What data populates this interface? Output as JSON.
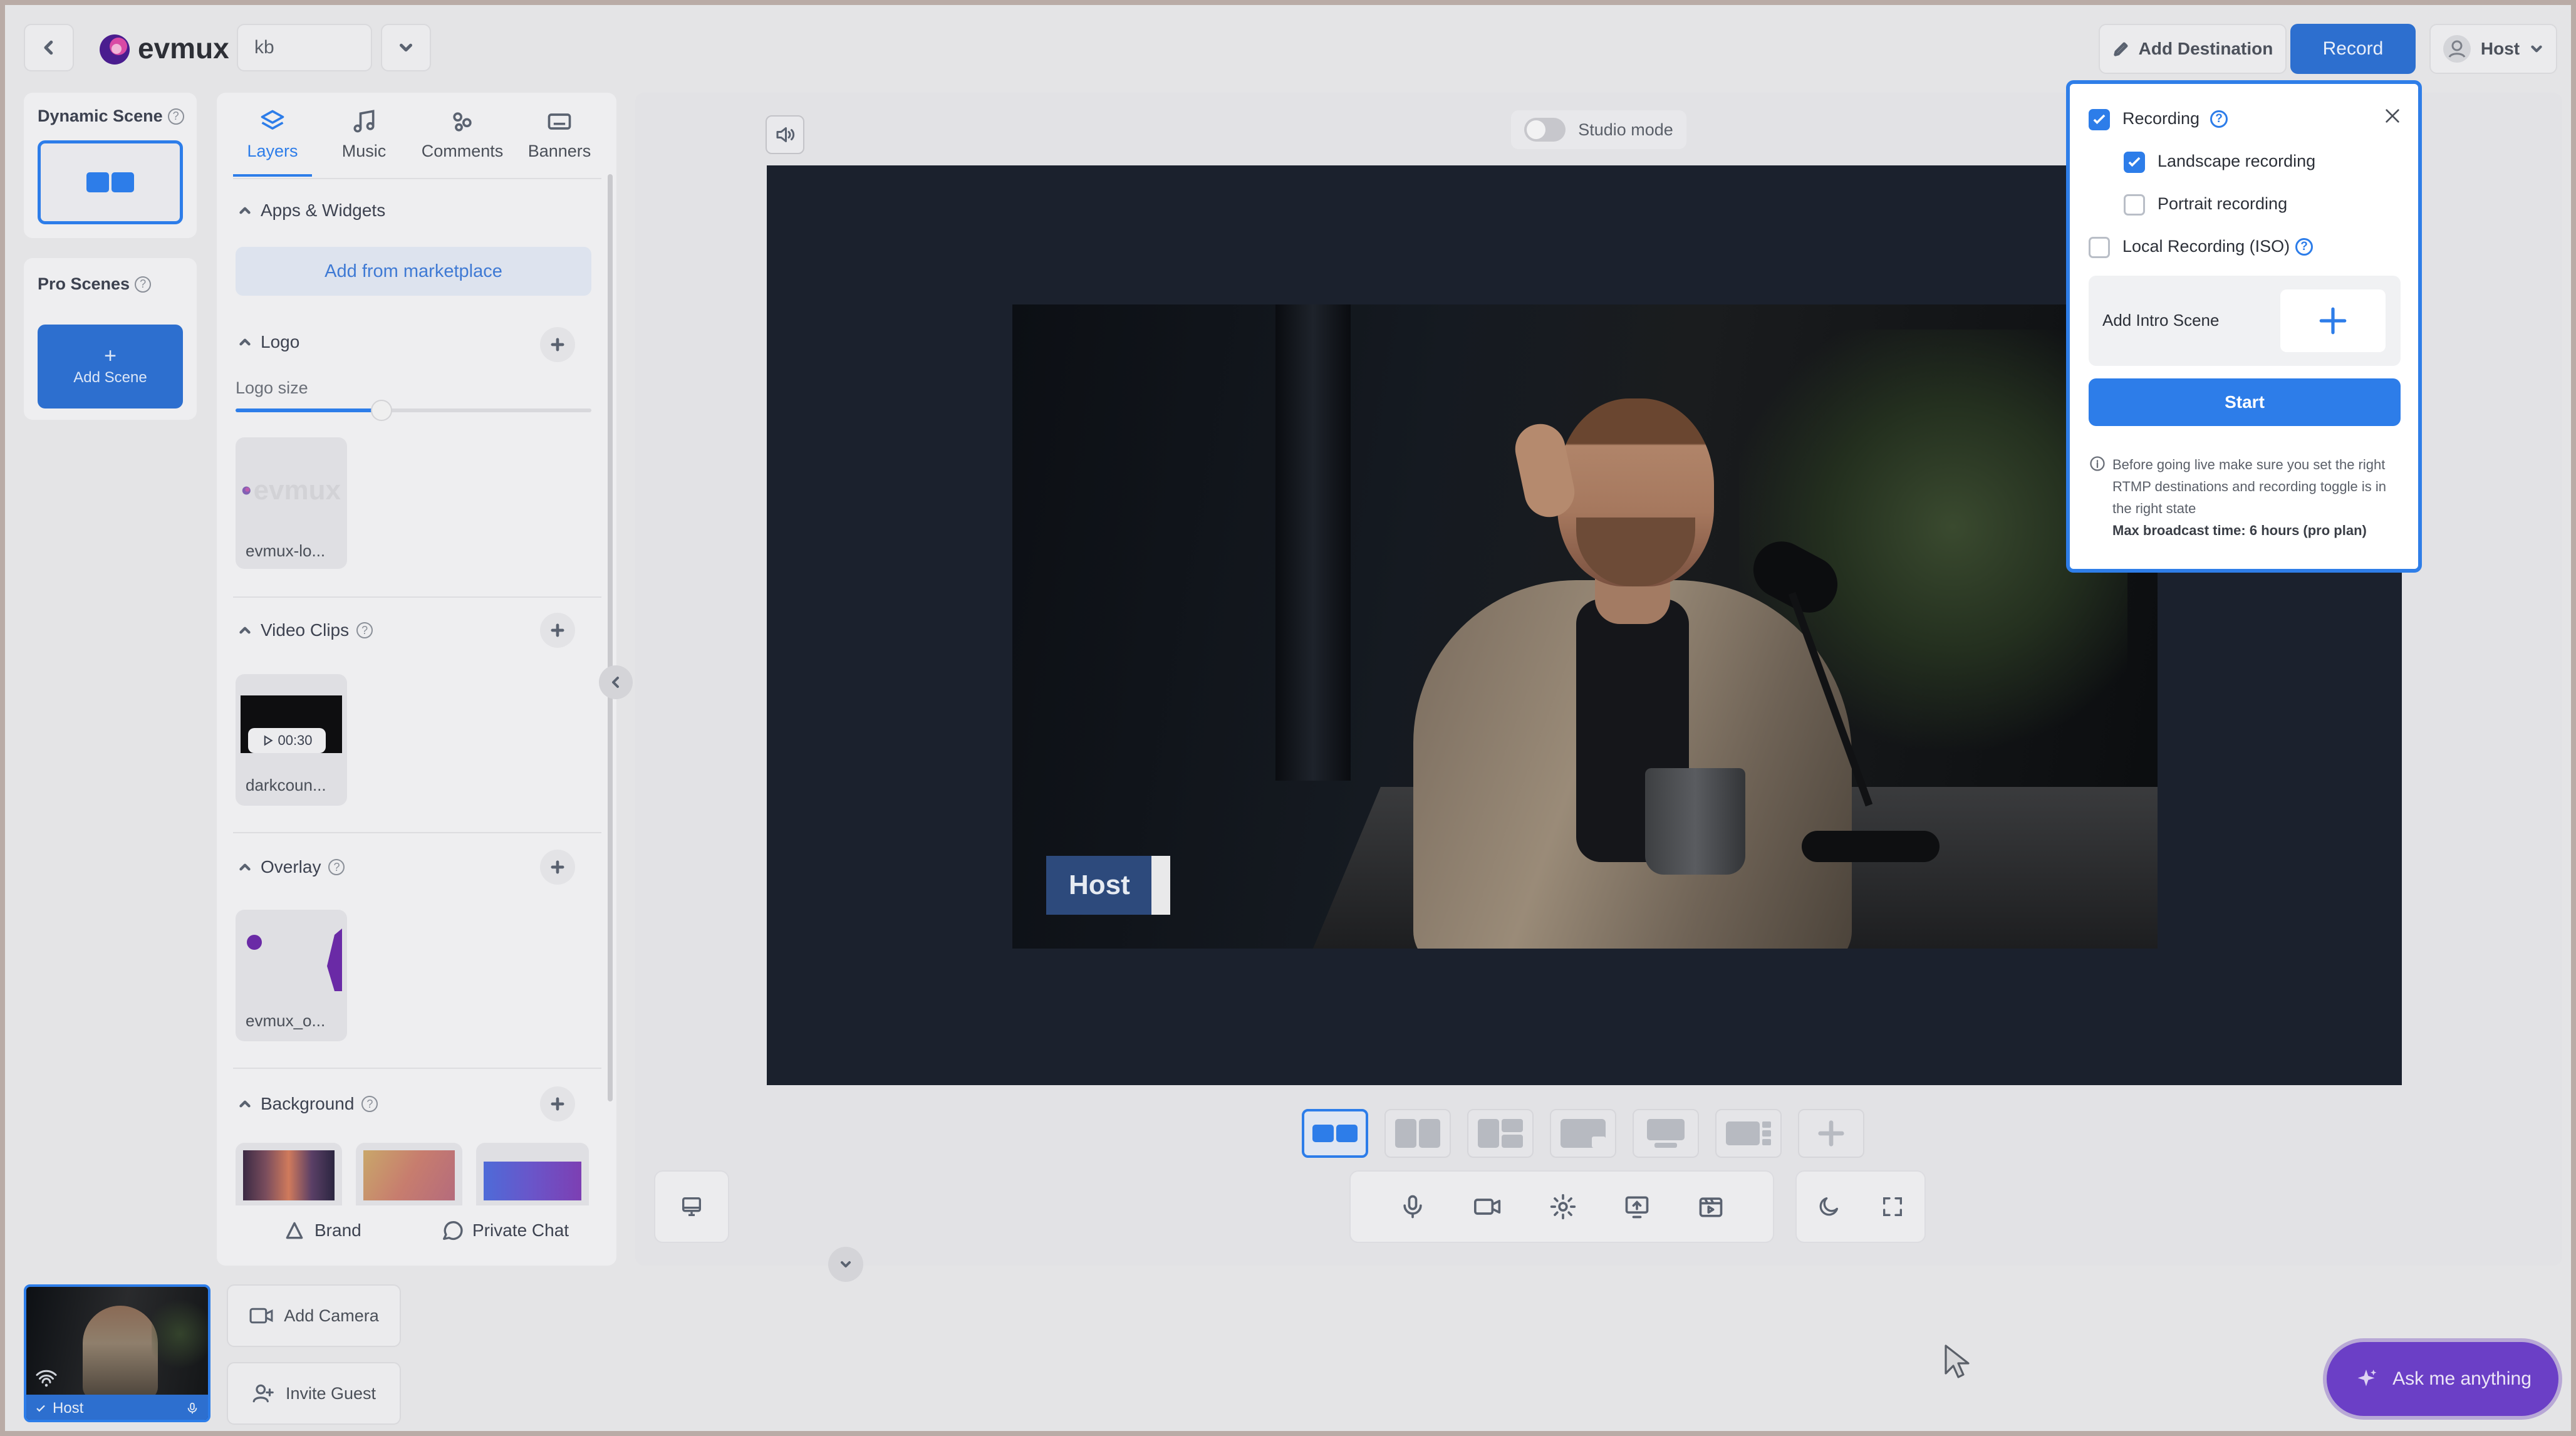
{
  "header": {
    "brand": "evmux",
    "session_name": "kb",
    "add_destination": "Add Destination",
    "record": "Record",
    "user": "Host"
  },
  "scenes": {
    "dynamic_title": "Dynamic Scene",
    "pro_title": "Pro Scenes",
    "add_scene": "Add Scene"
  },
  "tabs": [
    {
      "label": "Layers",
      "icon": "layers-icon"
    },
    {
      "label": "Music",
      "icon": "music-icon"
    },
    {
      "label": "Comments",
      "icon": "comments-icon"
    },
    {
      "label": "Banners",
      "icon": "banners-icon"
    }
  ],
  "layers": {
    "apps_widgets": "Apps & Widgets",
    "add_marketplace": "Add from marketplace",
    "logo": "Logo",
    "logo_size": "Logo size",
    "logo_size_fraction": 0.41,
    "logo_item": "evmux-lo...",
    "video_clips": "Video Clips",
    "clip_item": "darkcoun...",
    "clip_duration": "00:30",
    "overlay": "Overlay",
    "overlay_item": "evmux_o...",
    "background": "Background",
    "brand": "Brand",
    "private_chat": "Private Chat"
  },
  "stage": {
    "studio_mode": "Studio mode",
    "name_tag": "Host"
  },
  "popup": {
    "recording": "Recording",
    "landscape": "Landscape recording",
    "portrait": "Portrait recording",
    "local": "Local Recording (ISO)",
    "intro_scene": "Add Intro Scene",
    "start": "Start",
    "note": "Before going live make sure you set the right RTMP destinations and recording toggle is in the right state",
    "note_bold": "Max broadcast time: 6 hours (pro plan)",
    "recording_checked": true,
    "landscape_checked": true,
    "portrait_checked": false,
    "local_checked": false
  },
  "bottom": {
    "host_label": "Host",
    "add_camera": "Add Camera",
    "invite_guest": "Invite Guest",
    "ask": "Ask me anything"
  },
  "colors": {
    "accent": "#2d7de9",
    "ask_purple": "#6b3fc6"
  }
}
